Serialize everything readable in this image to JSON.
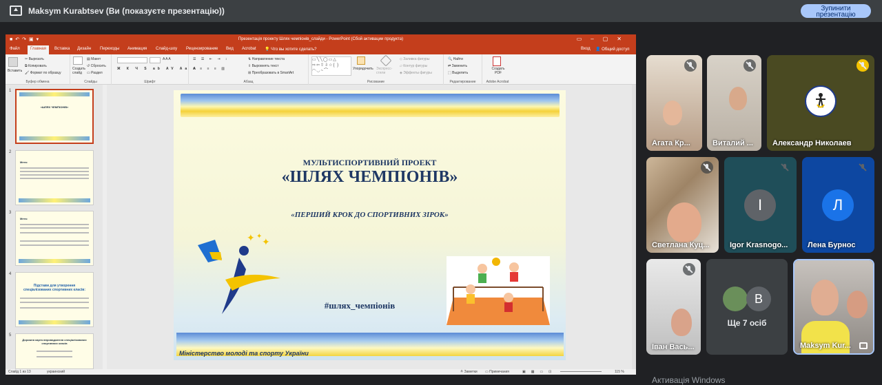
{
  "meet": {
    "title": "Maksym Kurabtsev (Ви (показуєте презентацію))",
    "stop_button_line1": "Зупинити",
    "stop_button_line2": "презентацію",
    "watermark": "Активація Windows"
  },
  "ppt": {
    "window_title": "Презентація проекту Шлях чемпіонів_слайди - PowerPoint (Сбой активации продукта)",
    "sign_in": "Вход",
    "share": "Общий доступ",
    "tabs": [
      "Файл",
      "Главная",
      "Вставка",
      "Дизайн",
      "Переходы",
      "Анимация",
      "Слайд-шоу",
      "Рецензирование",
      "Вид",
      "Acrobat"
    ],
    "search_placeholder": "Что вы хотите сделать?",
    "ribbon": {
      "paste": "Вставить",
      "cut": "Вырезать",
      "copy": "Копировать",
      "format_painter": "Формат по образцу",
      "clipboard": "Буфер обмена",
      "new_slide": "Создать слайд",
      "layout": "Макет",
      "reset": "Сбросить",
      "section": "Раздел",
      "slides": "Слайды",
      "font": "Шрифт",
      "text_direction": "Направление текста",
      "align_text": "Выровнять текст",
      "convert_smartart": "Преобразовать в SmartArt",
      "paragraph": "Абзац",
      "arrange": "Упорядочить",
      "quick_styles": "Экспресс-стили",
      "shape_fill": "Заливка фигуры",
      "shape_outline": "Контур фигуры",
      "shape_effects": "Эффекты фигуры",
      "drawing": "Рисование",
      "find": "Найти",
      "replace": "Заменить",
      "select": "Выделить",
      "editing": "Редактирование",
      "create_pdf": "Создать PDF",
      "adobe_acrobat": "Adobe Acrobat"
    },
    "thumb_numbers": [
      "1",
      "2",
      "3",
      "4",
      "5"
    ],
    "thumb_titles": [
      "«ШЛЯХ ЧЕМПІОНІВ»",
      "Мета:",
      "Мета:",
      "Підстави для утворення спеціалізованих спортивних класів:",
      "Дорожня карта впровадження спеціалізованих спортивних класів"
    ],
    "slide": {
      "subtitle": "МУЛЬТИСПОРТИВНИЙ ПРОЕКТ",
      "title": "«ШЛЯХ ЧЕМПІОНІВ»",
      "quote": "«ПЕРШИЙ КРОК  ДО  СПОРТИВНИХ ЗІРОК»",
      "hashtag": "#шлях_чемпіонів",
      "ministry": "Міністерство молоді та спорту України"
    },
    "status": {
      "slide_of": "Слайд 1 из 13",
      "language": "украинский",
      "notes": "Заметки",
      "comments": "Примечания",
      "zoom": "115 %"
    }
  },
  "participants": [
    {
      "name": "Агата Кр...",
      "muted": true
    },
    {
      "name": "Виталий ...",
      "muted": true
    },
    {
      "name": "Александр Николаев",
      "muted": true
    },
    {
      "name": "Светлана Куц...",
      "muted": true
    },
    {
      "name": "Igor Krasnogo...",
      "muted": true,
      "initial": "I"
    },
    {
      "name": "Лена Бурнос",
      "muted": true,
      "initial": "Л"
    },
    {
      "name": "Іван Вась...",
      "muted": true
    },
    {
      "name": "Ще 7 осіб",
      "initial": "В"
    },
    {
      "name": "Maksym Kur...",
      "muted": false
    }
  ],
  "colors": {
    "ppt_red": "#c43e1c",
    "meet_bg": "#202124",
    "tile_bg": "#3c4043",
    "avatar_blue": "#1a73e8",
    "avatar_grey": "#5f6368"
  }
}
